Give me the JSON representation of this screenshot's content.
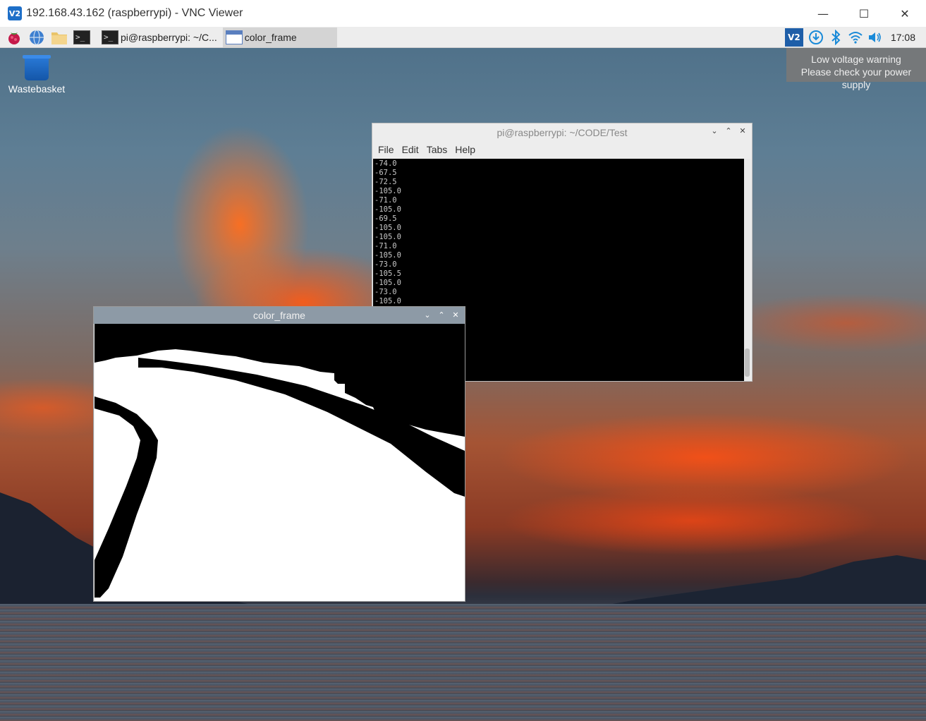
{
  "vnc": {
    "logo": "V2",
    "title": "192.168.43.162 (raspberrypi) - VNC Viewer",
    "minimize": "—",
    "maximize": "☐",
    "close": "✕"
  },
  "taskbar": {
    "tasks": [
      {
        "icon": "terminal-icon",
        "label": "pi@raspberrypi: ~/C..."
      },
      {
        "icon": "window-icon",
        "label": "color_frame"
      }
    ],
    "tray": {
      "vnc_label": "V2",
      "clock": "17:08"
    }
  },
  "tooltip": {
    "line1": "Low voltage warning",
    "line2": "Please check your power supply"
  },
  "desktop": {
    "wastebasket_label": "Wastebasket"
  },
  "terminal": {
    "title": "pi@raspberrypi: ~/CODE/Test",
    "menu": [
      "File",
      "Edit",
      "Tabs",
      "Help"
    ],
    "lines": [
      "-74.0",
      "-67.5",
      "-72.5",
      "-105.0",
      "-71.0",
      "-105.0",
      "-69.5",
      "-105.0",
      "-105.0",
      "-71.0",
      "-105.0",
      "-73.0",
      "-105.5",
      "-105.0",
      "-73.0",
      "-105.0"
    ]
  },
  "color_frame": {
    "title": "color_frame"
  },
  "controls": {
    "minimize": "⌄",
    "maximize": "⌃",
    "close": "✕"
  }
}
